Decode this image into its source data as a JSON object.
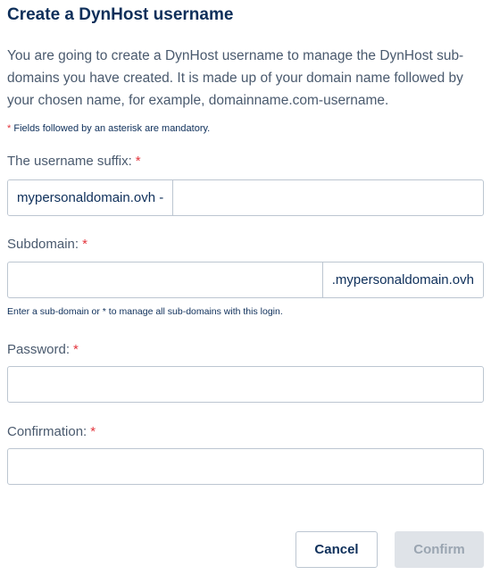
{
  "dialog": {
    "title": "Create a DynHost username",
    "intro": "You are going to create a DynHost username to manage the DynHost sub-domains you have created. It is made up of your domain name followed by your chosen name, for example, domainname.com-username.",
    "mandatory_note": "Fields followed by an asterisk are mandatory.",
    "asterisk": "*"
  },
  "fields": {
    "suffix": {
      "label": "The username suffix:",
      "prefix": "mypersonaldomain.ovh -",
      "value": ""
    },
    "subdomain": {
      "label": "Subdomain:",
      "suffix": ".mypersonaldomain.ovh",
      "value": "",
      "help": "Enter a sub-domain or * to manage all sub-domains with this login."
    },
    "password": {
      "label": "Password:",
      "value": ""
    },
    "confirmation": {
      "label": "Confirmation:",
      "value": ""
    }
  },
  "actions": {
    "cancel": "Cancel",
    "confirm": "Confirm"
  },
  "colors": {
    "title": "#0e2f5a",
    "required": "#e3353d",
    "disabled_button_bg": "#dfe3e8"
  }
}
